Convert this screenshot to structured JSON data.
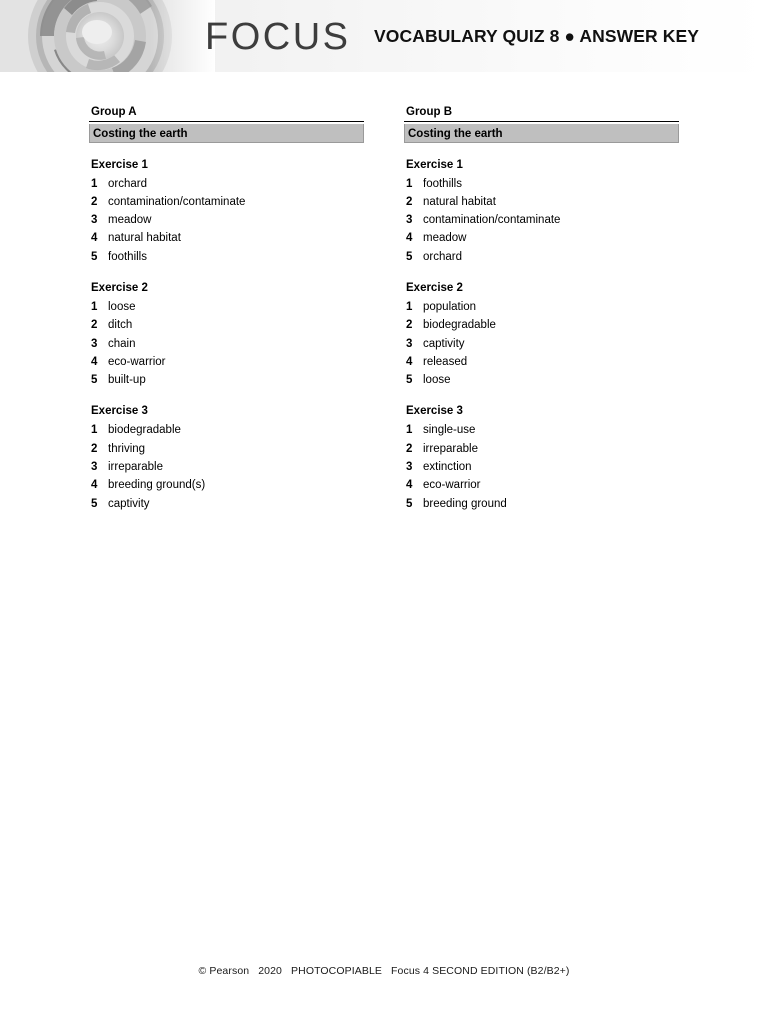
{
  "header": {
    "brand": "FOCUS",
    "title": "VOCABULARY QUIZ 8 ● ANSWER KEY",
    "logo_icon": "swirl-logo-icon",
    "background_start": "#e9e9e9",
    "background_end": "#ffffff",
    "wordmark_color": "#3d3d3d"
  },
  "colors": {
    "topic_band": "#bfbfbf",
    "rule": "#000000",
    "text": "#000000"
  },
  "columns": [
    {
      "group_label": "Group A",
      "topic": "Costing the earth",
      "exercises": [
        {
          "title": "Exercise 1",
          "answers": [
            {
              "num": "1",
              "text": "orchard"
            },
            {
              "num": "2",
              "text": "contamination/contaminate"
            },
            {
              "num": "3",
              "text": "meadow"
            },
            {
              "num": "4",
              "text": "natural habitat"
            },
            {
              "num": "5",
              "text": "foothills"
            }
          ]
        },
        {
          "title": "Exercise 2",
          "answers": [
            {
              "num": "1",
              "text": "loose"
            },
            {
              "num": "2",
              "text": "ditch"
            },
            {
              "num": "3",
              "text": "chain"
            },
            {
              "num": "4",
              "text": "eco-warrior"
            },
            {
              "num": "5",
              "text": "built-up"
            }
          ]
        },
        {
          "title": "Exercise 3",
          "answers": [
            {
              "num": "1",
              "text": "biodegradable"
            },
            {
              "num": "2",
              "text": "thriving"
            },
            {
              "num": "3",
              "text": "irreparable"
            },
            {
              "num": "4",
              "text": "breeding ground(s)"
            },
            {
              "num": "5",
              "text": "captivity"
            }
          ]
        }
      ]
    },
    {
      "group_label": "Group B",
      "topic": "Costing the earth",
      "exercises": [
        {
          "title": "Exercise 1",
          "answers": [
            {
              "num": "1",
              "text": "foothills"
            },
            {
              "num": "2",
              "text": "natural habitat"
            },
            {
              "num": "3",
              "text": "contamination/contaminate"
            },
            {
              "num": "4",
              "text": "meadow"
            },
            {
              "num": "5",
              "text": "orchard"
            }
          ]
        },
        {
          "title": "Exercise 2",
          "answers": [
            {
              "num": "1",
              "text": "population"
            },
            {
              "num": "2",
              "text": "biodegradable"
            },
            {
              "num": "3",
              "text": "captivity"
            },
            {
              "num": "4",
              "text": "released"
            },
            {
              "num": "5",
              "text": "loose"
            }
          ]
        },
        {
          "title": "Exercise 3",
          "answers": [
            {
              "num": "1",
              "text": "single-use"
            },
            {
              "num": "2",
              "text": "irreparable"
            },
            {
              "num": "3",
              "text": "extinction"
            },
            {
              "num": "4",
              "text": "eco-warrior"
            },
            {
              "num": "5",
              "text": "breeding ground"
            }
          ]
        }
      ]
    }
  ],
  "footer": {
    "copyright": "© Pearson",
    "year": "2020",
    "photocopiable": "PHOTOCOPIABLE",
    "edition": "Focus 4 SECOND EDITION (B2/B2+)"
  }
}
